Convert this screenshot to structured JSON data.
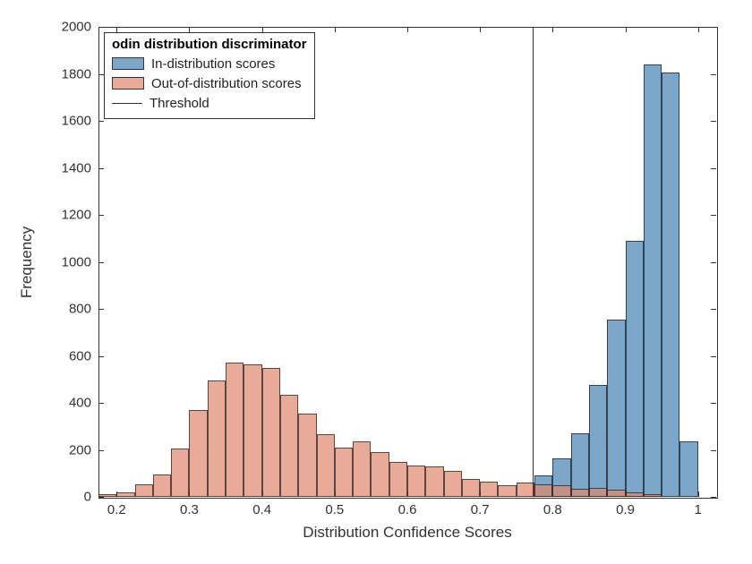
{
  "chart_data": {
    "type": "bar",
    "title": "",
    "xlabel": "Distribution Confidence Scores",
    "ylabel": "Frequency",
    "xlim": [
      0.175,
      1.025
    ],
    "ylim": [
      0,
      2000
    ],
    "xticks": [
      0.2,
      0.3,
      0.4,
      0.5,
      0.6,
      0.7,
      0.8,
      0.9,
      1.0
    ],
    "yticks": [
      0,
      200,
      400,
      600,
      800,
      1000,
      1200,
      1400,
      1600,
      1800,
      2000
    ],
    "bin_width": 0.025,
    "bin_left_edges": [
      0.175,
      0.2,
      0.225,
      0.25,
      0.275,
      0.3,
      0.325,
      0.35,
      0.375,
      0.4,
      0.425,
      0.45,
      0.475,
      0.5,
      0.525,
      0.55,
      0.575,
      0.6,
      0.625,
      0.65,
      0.675,
      0.7,
      0.725,
      0.75,
      0.775,
      0.8,
      0.825,
      0.85,
      0.875,
      0.9,
      0.925,
      0.95,
      0.975,
      1.0
    ],
    "threshold": 0.773,
    "series": [
      {
        "name": "In-distribution scores",
        "key": "in",
        "color": "#4682B4",
        "values": [
          0,
          0,
          0,
          0,
          0,
          0,
          0,
          0,
          0,
          0,
          0,
          0,
          0,
          0,
          0,
          0,
          0,
          0,
          0,
          0,
          0,
          0,
          0,
          0,
          90,
          165,
          270,
          475,
          755,
          1090,
          1840,
          1805,
          235,
          0
        ]
      },
      {
        "name": "Out-of-distribution scores",
        "key": "out",
        "color": "#DE876C",
        "values": [
          10,
          20,
          55,
          95,
          205,
          370,
          495,
          570,
          565,
          550,
          435,
          355,
          265,
          210,
          235,
          190,
          150,
          135,
          130,
          110,
          75,
          65,
          50,
          60,
          55,
          50,
          35,
          40,
          30,
          20,
          10,
          0,
          0,
          0
        ]
      }
    ],
    "legend": {
      "title": "odin distribution discriminator",
      "items": [
        {
          "kind": "swatch",
          "class": "in",
          "label": "In-distribution scores"
        },
        {
          "kind": "swatch",
          "class": "out",
          "label": "Out-of-distribution scores"
        },
        {
          "kind": "line",
          "label": "Threshold"
        }
      ]
    }
  }
}
